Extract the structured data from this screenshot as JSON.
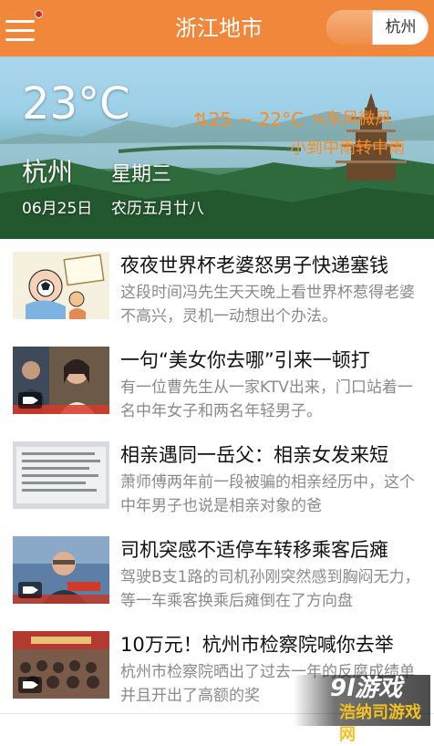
{
  "header": {
    "title": "浙江地市",
    "city_selector": "杭州",
    "menu_icon": "hamburger-menu-icon",
    "notification_color": "#d8262b",
    "background_color": "#f0873a"
  },
  "weather": {
    "temperature": "23°C",
    "range_arrow": "⇅",
    "range": "25 ~ 22°C",
    "wind_icon": "wind-icon",
    "wind": "东风微风",
    "condition": "小到中雨转中雨",
    "city": "杭州",
    "weekday": "星期三",
    "date": "06月25日",
    "lunar_date": "农历五月廿八",
    "highlight_color": "#ff8a1e"
  },
  "news": [
    {
      "title": "夜夜世界杯老婆怒男子快递塞钱",
      "desc": "这段时间冯先生天天晚上看世界杯惹得老婆不高兴，灵机一动想出个办法。",
      "has_video": false,
      "thumb": "cartoon"
    },
    {
      "title": "一句“美女你去哪”引来一顿打",
      "desc": "有一位曹先生从一家KTV出来，门口站着一名中年女子和两名年轻男子。",
      "has_video": true,
      "thumb": "video-interview"
    },
    {
      "title": "相亲遇同一岳父：相亲女发来短",
      "desc": "萧师傅两年前一段被骗的相亲经历中，这个中年男子也说是相亲对象的爸",
      "has_video": false,
      "thumb": "text-message"
    },
    {
      "title": "司机突感不适停车转移乘客后瘫",
      "desc": "驾驶B支1路的司机孙刚突然感到胸闷无力，等一车乘客换乘后瘫倒在了方向盘",
      "has_video": true,
      "thumb": "video-news"
    },
    {
      "title": "10万元！杭州市检察院喊你去举",
      "desc": "杭州市检察院晒出了过去一年的反腐成绩单并且开出了高额的奖",
      "has_video": true,
      "thumb": "video-meeting"
    }
  ],
  "watermark": {
    "logo": "9l游戏",
    "site": "浩纳司游戏网"
  }
}
